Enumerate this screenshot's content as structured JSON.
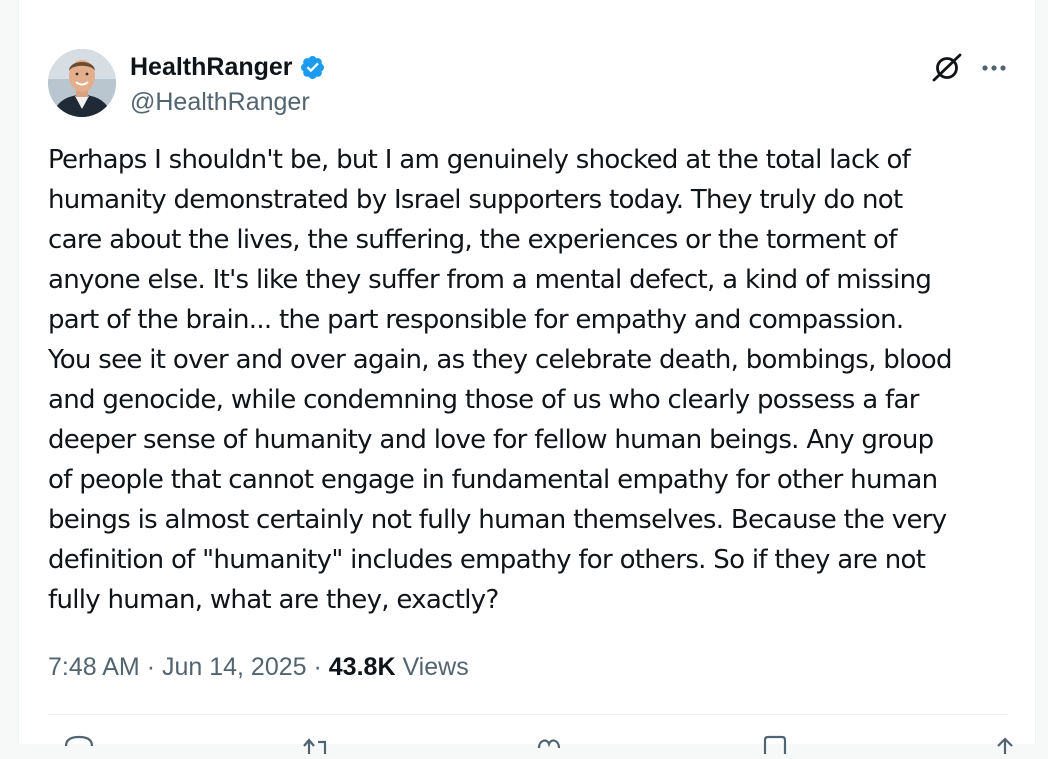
{
  "tweet": {
    "author": {
      "display_name": "HealthRanger",
      "handle": "@HealthRanger",
      "verified": true,
      "avatar_icon": "user-avatar-photo"
    },
    "header_actions": {
      "grok_icon": "grok-icon",
      "more_icon": "more-options-icon"
    },
    "text": "Perhaps I shouldn't be, but I am genuinely shocked at the total lack of\nhumanity demonstrated by Israel supporters today. They truly do not\ncare about the lives, the suffering, the experiences or the torment of\nanyone else. It's like they suffer from a mental defect, a kind of missing\npart of the brain... the part responsible for empathy and compassion.\nYou see it over and over again, as they celebrate death, bombings, blood\nand genocide, while condemning those of us who clearly possess a far\ndeeper sense of humanity and love for fellow human beings. Any group\nof people that cannot engage in fundamental empathy for other human\nbeings is almost certainly not fully human themselves. Because the very\ndefinition of \"humanity\" includes empathy for others. So if they are not\nfully human, what are they, exactly?",
    "meta": {
      "time": "7:48 AM",
      "separator": "·",
      "date": "Jun 14, 2025",
      "views_count": "43.8K",
      "views_label": "Views"
    },
    "actions": [
      "reply-icon",
      "retweet-icon",
      "like-icon",
      "bookmark-icon",
      "share-icon"
    ]
  },
  "colors": {
    "text_primary": "#0f1419",
    "text_secondary": "#536471",
    "verified_blue": "#1d9bf0",
    "divider": "#eff3f4"
  }
}
